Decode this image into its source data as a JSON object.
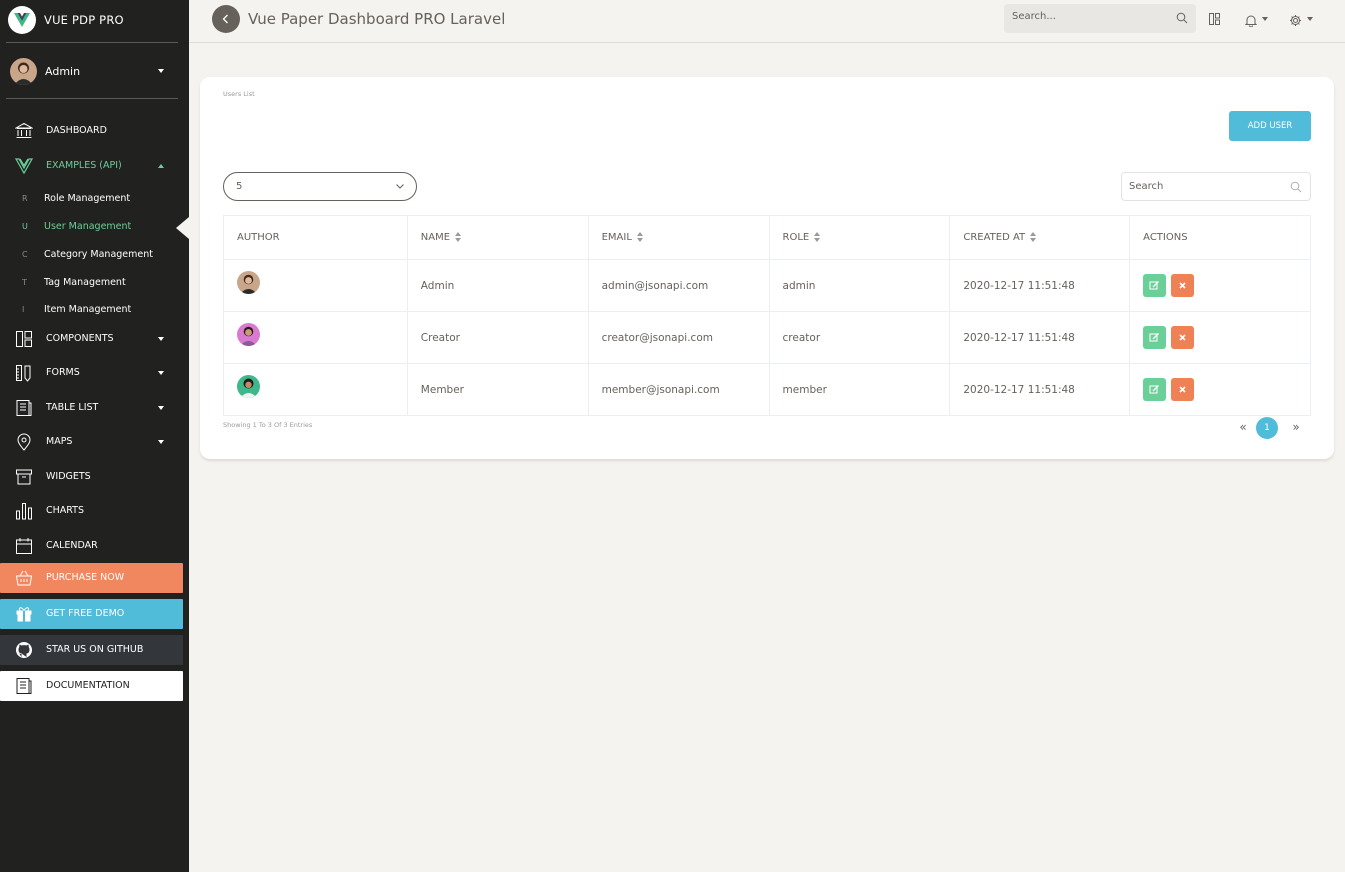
{
  "brand": {
    "name": "VUE PDP PRO"
  },
  "user": {
    "name": "Admin"
  },
  "sidebar": {
    "items": [
      {
        "label": "DASHBOARD"
      },
      {
        "label": "EXAMPLES (API)"
      },
      {
        "label": "COMPONENTS"
      },
      {
        "label": "FORMS"
      },
      {
        "label": "TABLE LIST"
      },
      {
        "label": "MAPS"
      },
      {
        "label": "WIDGETS"
      },
      {
        "label": "CHARTS"
      },
      {
        "label": "CALENDAR"
      }
    ],
    "subitems": [
      {
        "abbr": "R",
        "label": "Role Management"
      },
      {
        "abbr": "U",
        "label": "User Management"
      },
      {
        "abbr": "C",
        "label": "Category Management"
      },
      {
        "abbr": "T",
        "label": "Tag Management"
      },
      {
        "abbr": "I",
        "label": "Item Management"
      }
    ],
    "buttons": [
      {
        "label": "PURCHASE NOW",
        "color": "#f0875f"
      },
      {
        "label": "GET FREE DEMO",
        "color": "#51bcda"
      },
      {
        "label": "STAR US ON GITHUB",
        "color": "#33373c"
      },
      {
        "label": "DOCUMENTATION",
        "color": "#ffffff"
      }
    ]
  },
  "navbar": {
    "title": "Vue Paper Dashboard PRO Laravel",
    "search_placeholder": "Search..."
  },
  "card": {
    "category": "Users List",
    "add_button": "ADD USER",
    "per_page": "5",
    "search_placeholder": "Search",
    "columns": [
      "AUTHOR",
      "NAME",
      "EMAIL",
      "ROLE",
      "CREATED AT",
      "ACTIONS"
    ],
    "rows": [
      {
        "name": "Admin",
        "email": "admin@jsonapi.com",
        "role": "admin",
        "created_at": "2020-12-17 11:51:48"
      },
      {
        "name": "Creator",
        "email": "creator@jsonapi.com",
        "role": "creator",
        "created_at": "2020-12-17 11:51:48"
      },
      {
        "name": "Member",
        "email": "member@jsonapi.com",
        "role": "member",
        "created_at": "2020-12-17 11:51:48"
      }
    ],
    "footer": "Showing 1 To 3 Of 3 Entries",
    "pager": {
      "prev": "«",
      "current": "1",
      "next": "»"
    }
  },
  "colors": {
    "accent": "#51bcda",
    "success": "#6bd098",
    "danger": "#ef8157",
    "sidebar": "#212120"
  }
}
